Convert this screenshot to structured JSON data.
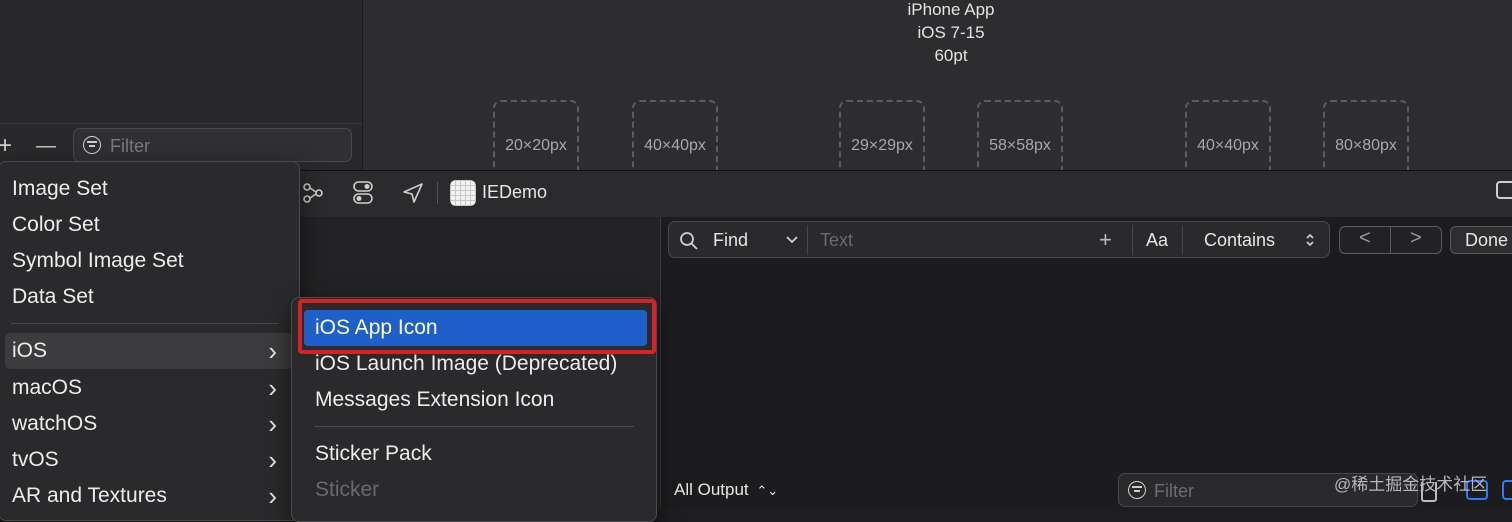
{
  "navigator": {
    "add_symbol": "+",
    "remove_symbol": "—",
    "filter_placeholder": "Filter"
  },
  "canvas": {
    "title_lines": [
      "iPhone App",
      "iOS 7-15",
      "60pt"
    ],
    "slots": [
      "20×20px",
      "40×40px",
      "29×29px",
      "58×58px",
      "40×40px",
      "80×80px"
    ]
  },
  "toolbar": {
    "scheme_name": "IEDemo"
  },
  "find_bar": {
    "mode": "Find",
    "text_placeholder": "Text",
    "plus": "+",
    "case_toggle": "Aa",
    "match_type": "Contains",
    "prev": "<",
    "next": ">",
    "done": "Done"
  },
  "console": {
    "output_selector": "All Output",
    "filter_placeholder": "Filter",
    "watermark": "@稀土掘金技术社区"
  },
  "main_menu": {
    "items": [
      "Image Set",
      "Color Set",
      "Symbol Image Set",
      "Data Set"
    ],
    "platforms": [
      "iOS",
      "macOS",
      "watchOS",
      "tvOS",
      "AR and Textures"
    ]
  },
  "sub_menu": {
    "items": [
      "iOS App Icon",
      "iOS Launch Image (Deprecated)",
      "Messages Extension Icon"
    ],
    "items2": [
      "Sticker Pack",
      "Sticker"
    ]
  },
  "colors": {
    "selection": "#1f5fca",
    "annotation_box": "#d72127",
    "accent": "#2f7bf5"
  }
}
